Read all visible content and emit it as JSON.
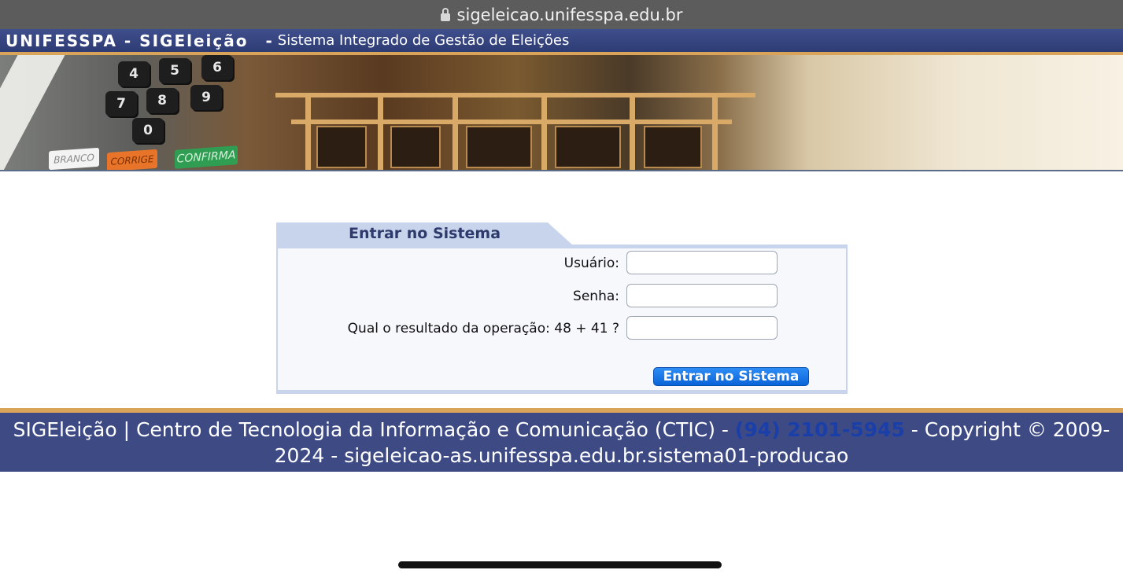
{
  "browser": {
    "url": "sigeleicao.unifesspa.edu.br"
  },
  "header": {
    "brand": "UNIFESSPA - SIGEleição",
    "separator": "-",
    "subtitle": "Sistema Integrado de Gestão de Eleições"
  },
  "banner": {
    "keys": [
      "4",
      "5",
      "6",
      "7",
      "8",
      "9",
      "0"
    ],
    "key_branco": "BRANCO",
    "key_corrige": "CORRIGE",
    "key_confirma": "CONFIRMA"
  },
  "login": {
    "title": "Entrar no Sistema",
    "username_label": "Usuário:",
    "username_value": "",
    "password_label": "Senha:",
    "password_value": "",
    "captcha_label": "Qual o resultado da operação: 48 + 41 ?",
    "captcha_value": "",
    "submit_label": "Entrar no Sistema"
  },
  "footer": {
    "text_before": "SIGEleição | Centro de Tecnologia da Informação e Comunicação (CTIC) - ",
    "phone": "(94) 2101-5945",
    "text_after": " - Copyright © 2009-2024 - sigeleicao-as.unifesspa.edu.br.sistema01-producao"
  },
  "colors": {
    "header_bg": "#3f4f8c",
    "accent_orange": "#d9a35a",
    "tab_bg": "#c8d4ec",
    "button_blue": "#0a63d8",
    "footer_bg": "#3d4a84",
    "phone_link": "#1b3fa8"
  }
}
